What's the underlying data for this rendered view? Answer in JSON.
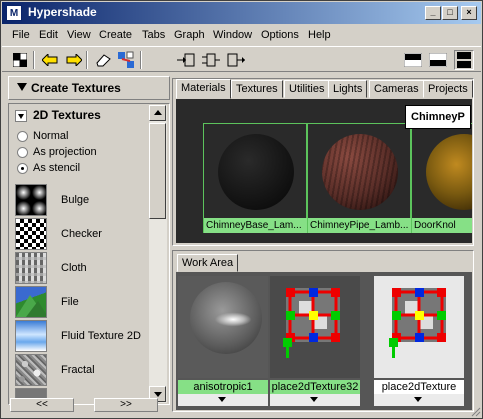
{
  "window": {
    "title": "Hypershade",
    "app_icon_text": "M",
    "controls": [
      "_",
      "□",
      "×"
    ]
  },
  "menubar": {
    "items": [
      "File",
      "Edit",
      "View",
      "Create",
      "Tabs",
      "Graph",
      "Window",
      "Options",
      "Help"
    ]
  },
  "toolbar": {
    "icons": [
      "checker-icon",
      "arrow-left-icon",
      "arrow-right-icon",
      "eraser-icon",
      "graph-network-icon",
      "input-connection-icon",
      "input-output-icon",
      "output-connection-icon",
      "layout-top-icon",
      "layout-bottom-icon",
      "layout-split-icon"
    ]
  },
  "create_panel": {
    "header": "Create Textures",
    "section": "2D Textures",
    "radios": [
      {
        "label": "Normal",
        "selected": false
      },
      {
        "label": "As projection",
        "selected": false
      },
      {
        "label": "As stencil",
        "selected": true
      }
    ],
    "textures": [
      {
        "label": "Bulge",
        "icon": "bulge-texture-icon"
      },
      {
        "label": "Checker",
        "icon": "checker-texture-icon"
      },
      {
        "label": "Cloth",
        "icon": "cloth-texture-icon"
      },
      {
        "label": "File",
        "icon": "file-texture-icon"
      },
      {
        "label": "Fluid Texture 2D",
        "icon": "fluid-texture-icon"
      },
      {
        "label": "Fractal",
        "icon": "fractal-texture-icon"
      }
    ],
    "nav_prev": "<<",
    "nav_next": ">>"
  },
  "top_tabs": {
    "tabs": [
      "Materials",
      "Textures",
      "Utilities",
      "Lights",
      "Cameras",
      "Projects"
    ],
    "active": "Materials",
    "swatches": [
      {
        "label": "ChimneyBase_Lam...",
        "color": "#1a1a1a"
      },
      {
        "label": "ChimneyPipe_Lamb...",
        "color": "#5a2e28"
      },
      {
        "label": "DoorKnol",
        "color": "#7a5a10"
      }
    ],
    "popup_label": "ChimneyP"
  },
  "work_area": {
    "tab": "Work Area",
    "nodes": [
      {
        "label": "anisotropic1"
      },
      {
        "label": "place2dTexture32"
      },
      {
        "label": "place2dTexture"
      }
    ]
  }
}
